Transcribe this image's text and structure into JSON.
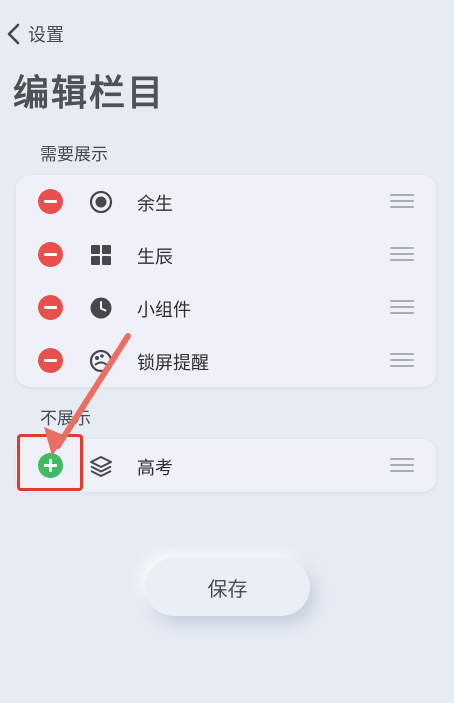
{
  "header": {
    "back_label": "设置",
    "title": "编辑栏目"
  },
  "sections": {
    "shown": {
      "label": "需要展示",
      "items": [
        {
          "label": "余生",
          "icon": "radio-circle-icon",
          "action": "remove"
        },
        {
          "label": "生辰",
          "icon": "grid-icon",
          "action": "remove"
        },
        {
          "label": "小组件",
          "icon": "clock-icon",
          "action": "remove"
        },
        {
          "label": "锁屏提醒",
          "icon": "palette-icon",
          "action": "remove"
        }
      ]
    },
    "hidden": {
      "label": "不展示",
      "items": [
        {
          "label": "高考",
          "icon": "layers-icon",
          "action": "add"
        }
      ]
    }
  },
  "save_label": "保存",
  "colors": {
    "background": "#e7ecf4",
    "card": "#eef2f8",
    "remove": "#e9504d",
    "add": "#3fbc62",
    "annotation": "#e43a2c"
  }
}
